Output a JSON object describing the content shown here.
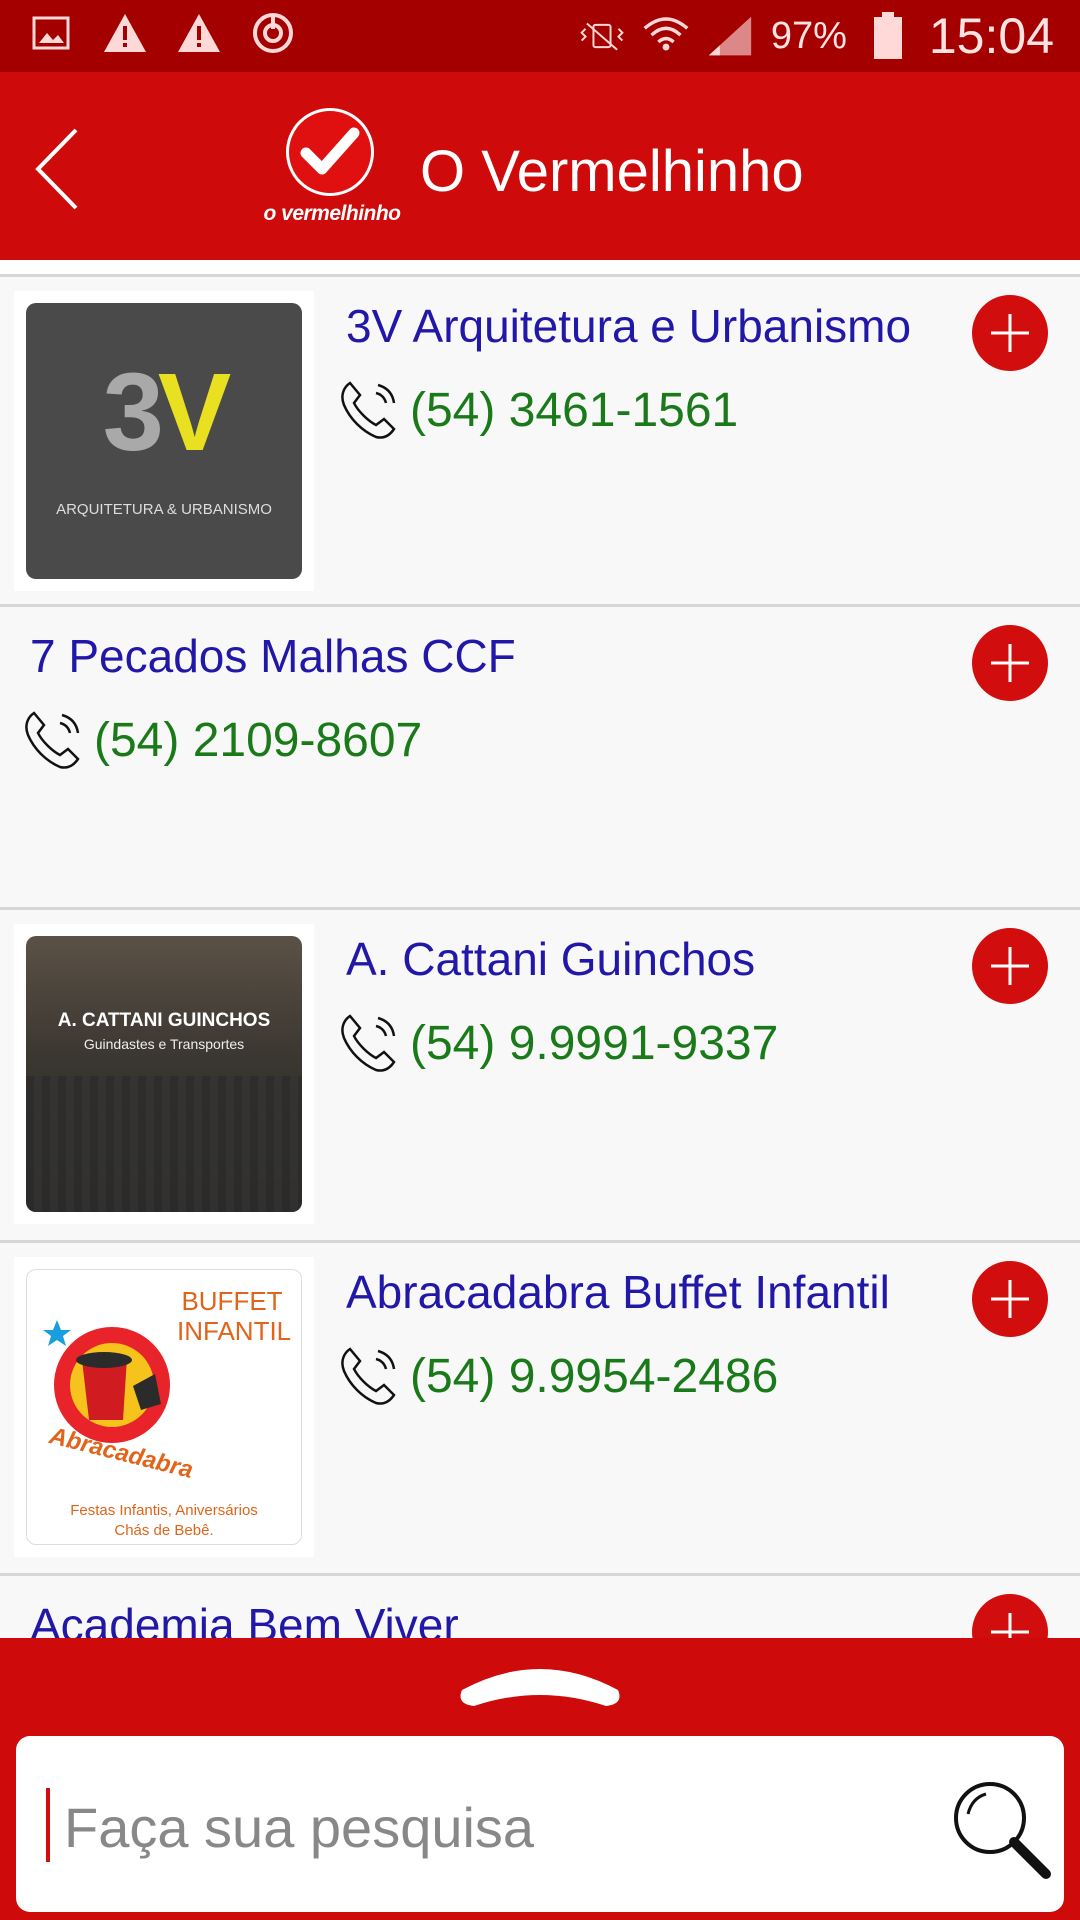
{
  "status_bar": {
    "battery": "97%",
    "time": "15:04"
  },
  "header": {
    "title": "O Vermelhinho",
    "logo_caption": "o vermelhinho"
  },
  "items": [
    {
      "name": "3V Arquitetura e Urbanismo",
      "phone": "(54) 3461-1561",
      "thumb": {
        "big": "3V",
        "sub": "ARQUITETURA & URBANISMO"
      }
    },
    {
      "name": "7 Pecados Malhas CCF",
      "phone": "(54) 2109-8607"
    },
    {
      "name": "A. Cattani Guinchos",
      "phone": "(54) 9.9991-9337",
      "thumb": {
        "big": "A. CATTANI GUINCHOS",
        "sub": "Guindastes e Transportes"
      }
    },
    {
      "name": "Abracadabra Buffet Infantil",
      "phone": "(54) 9.9954-2486",
      "thumb": {
        "big": "BUFFET INFANTIL",
        "brand": "Abracadabra",
        "sub": "Festas Infantis, Aniversários",
        "sub2": "Chás de Bebê."
      }
    },
    {
      "name": "Academia Bem Viver"
    }
  ],
  "search": {
    "placeholder": "Faça sua pesquisa"
  },
  "colors": {
    "primary": "#cf0a0a",
    "status_bar": "#a50000",
    "name_text": "#2218a8",
    "phone_text": "#1a7a1a"
  }
}
